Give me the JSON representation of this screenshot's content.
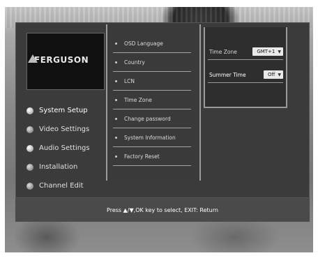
{
  "brand": {
    "logo_text": "FERGUSON"
  },
  "main_menu": {
    "items": [
      {
        "label": "System Setup"
      },
      {
        "label": "Video Settings"
      },
      {
        "label": "Audio Settings"
      },
      {
        "label": "Installation"
      },
      {
        "label": "Channel Edit"
      }
    ]
  },
  "system_setup_menu": {
    "items": [
      {
        "label": "OSD Language"
      },
      {
        "label": "Country"
      },
      {
        "label": "LCN"
      },
      {
        "label": "Time Zone"
      },
      {
        "label": "Change password"
      },
      {
        "label": "System Information"
      },
      {
        "label": "Factory Reset"
      }
    ]
  },
  "time_zone_settings": {
    "time_zone": {
      "label": "Time Zone",
      "value": "GMT+1"
    },
    "summer_time": {
      "label": "Summer Time",
      "value": "Off"
    }
  },
  "footer": {
    "hint": "Press ▲/▼,OK key to select, EXIT: Return"
  },
  "icons": {
    "bullet": "menu-bullet-icon",
    "dot": "submenu-dot-icon",
    "caret": "dropdown-caret-icon",
    "logo": "ferguson-logo-mark"
  }
}
